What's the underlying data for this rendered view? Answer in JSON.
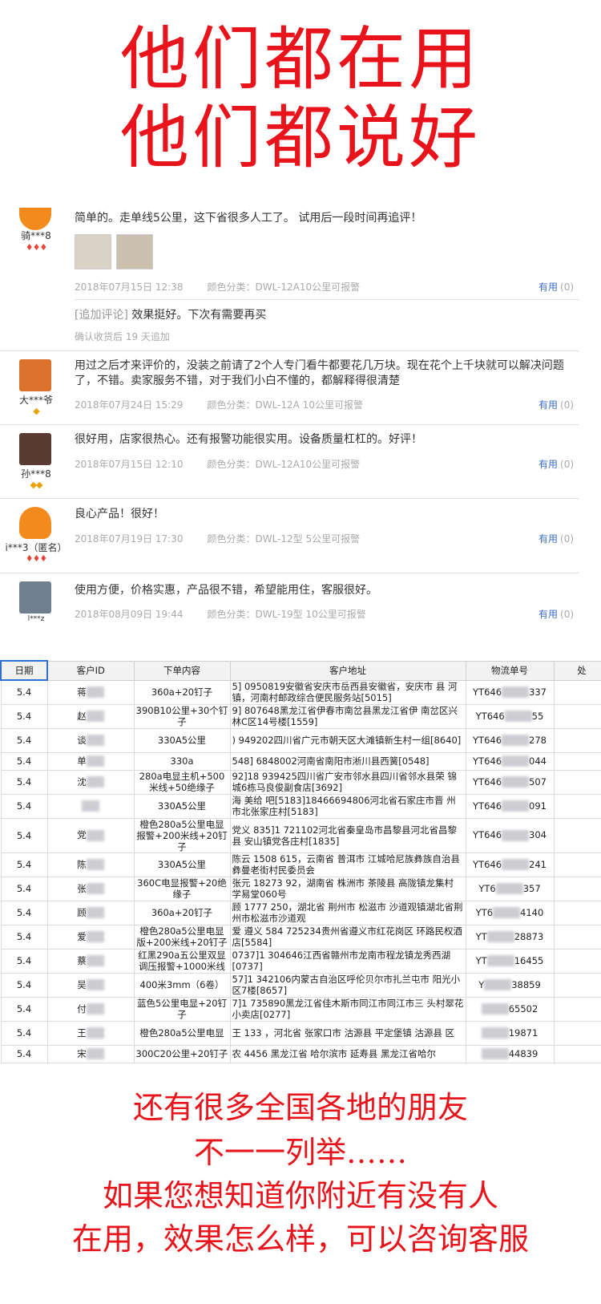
{
  "headline": {
    "line1": "他们都在用",
    "line2": "他们都说好"
  },
  "useful_label": "有用",
  "useful_count": "(0)",
  "color_prefix": "颜色分类：",
  "reviews": [
    {
      "user": "骑***8",
      "text": "简单的。走单线5公里，这下省很多人工了。 试用后一段时间再追评！",
      "date": "2018年07月15日 12:38",
      "color": "DWL-12A10公里可报警",
      "avatar_color": "#f28a1d",
      "followup_tag": "[追加评论]",
      "followup": "效果挺好。下次有需要再买",
      "followup_meta": "确认收货后 19 天追加"
    },
    {
      "user": "大***爷",
      "text": "用过之后才来评价的，没装之前请了2个人专门看牛都要花几万块。现在花个上千块就可以解决问题了，不错。卖家服务不错，对于我们小白不懂的，都解释得很清楚",
      "date": "2018年07月24日 15:29",
      "color": "DWL-12A 10公里可报警",
      "avatar_color": "#d9722a"
    },
    {
      "user": "孙***8",
      "text": "很好用，店家很热心。还有报警功能很实用。设备质量杠杠的。好评！",
      "date": "2018年07月15日 12:10",
      "color": "DWL-12A10公里可报警",
      "avatar_color": "#5a3b32"
    },
    {
      "user": "i***3（匿名）",
      "text": "良心产品！很好！",
      "date": "2018年07月19日 17:30",
      "color": "DWL-12型 5公里可报警",
      "avatar_color": "#f28a1d"
    },
    {
      "user": "l***z",
      "text": "使用方便，价格实惠，产品很不错，希望能用住，客服很好。",
      "date": "2018年08月09日 19:44",
      "color": "DWL-19型 10公里可报警",
      "avatar_color": "#6f7f8f"
    }
  ],
  "table": {
    "headers": [
      "日期",
      "客户ID",
      "下单内容",
      "客户地址",
      "物流单号",
      "处"
    ],
    "rows": [
      {
        "date": "5.4",
        "id": "蒋",
        "content": "360a+20钉子",
        "addr": "5]    0950819安徽省安庆市岳西县安徽省，安庆市    县    河镇，河南村邮政综合便民服务站[5015]",
        "track": "YT646",
        "track_tail": "337"
      },
      {
        "date": "5.4",
        "id": "赵",
        "content": "390B10公里+30个钉子",
        "addr": "9]    807648黑龙江省伊春市南岔县黑龙江省伊    南岔区兴林C区14号楼[1559]",
        "track": "YT646",
        "track_tail": "55"
      },
      {
        "date": "5.4",
        "id": "谈",
        "content": "330A5公里",
        "addr": ")    949202四川省广元市朝天区大滩镇新生村一组[8640]",
        "track": "YT646",
        "track_tail": "278"
      },
      {
        "date": "5.4",
        "id": "单",
        "content": "330a",
        "addr": "548]    6848002河南省南阳市淅川县西簧[0548]",
        "track": "YT646",
        "track_tail": "044"
      },
      {
        "date": "5.4",
        "id": "沈",
        "content": "280a电显主机+500米线+50绝缘子",
        "addr": "92]18    939425四川省广安市邻水县四川省邻水县荣    锦城6栋马良俊副食店[3692]",
        "track": "YT646",
        "track_tail": "507"
      },
      {
        "date": "5.4",
        "id": "",
        "content": "330A5公里",
        "addr": "海    美给    吧[5183]18466694806河北省石家庄市晋    州市北张家庄村[5183]",
        "track": "YT646",
        "track_tail": "091"
      },
      {
        "date": "5.4",
        "id": "党",
        "content": "橙色280a5公里电显报警+200米线+20钉子",
        "addr": "党义    835]1    721102河北省秦皇岛市昌黎县河北省昌黎县    安山镇党各庄村[1835]",
        "track": "YT646",
        "track_tail": "304"
      },
      {
        "date": "5.4",
        "id": "陈",
        "content": "330A5公里",
        "addr": "陈云    1508    615，云南省 普洱市 江城哈尼族彝族自治县    彝曼老街村民委员会",
        "track": "YT646",
        "track_tail": "241"
      },
      {
        "date": "5.4",
        "id": "张",
        "content": "360C电显报警+20绝缘子",
        "addr": "张元    18273    92，湖南省 株洲市 茶陵县 高陇镇龙集村    学易堂060号",
        "track": "YT6",
        "track_tail": "357"
      },
      {
        "date": "5.4",
        "id": "顾",
        "content": "360a+20钉子",
        "addr": "顾    1777    250，湖北省 荆州市 松滋市 沙道观镇湖北省荆州市松滋市沙道观",
        "track": "YT6",
        "track_tail": "4140"
      },
      {
        "date": "5.4",
        "id": "爱",
        "content": "橙色280a5公里电显版+200米线+20钉子",
        "addr": "爱    遵义    584    725234贵州省遵义市红花岗区    环路民权酒店[5584]",
        "track": "YT",
        "track_tail": "28873"
      },
      {
        "date": "5.4",
        "id": "蔡",
        "content": "红黑290a五公里双显调压报警+1000米线",
        "addr": "0737]1    304646江西省赣州市龙南市程龙镇龙秀西湖[0737]",
        "track": "YT",
        "track_tail": "16455"
      },
      {
        "date": "5.4",
        "id": "吴",
        "content": "400米3mm（6卷）",
        "addr": "57]1    342106内蒙古自治区呼伦贝尔市扎兰屯市    阳光小区7楼[8657]",
        "track": "Y",
        "track_tail": "38859"
      },
      {
        "date": "5.4",
        "id": "付",
        "content": "蓝色5公里电显+20钉子",
        "addr": "7]1    735890黑龙江省佳木斯市同江市同江市三    头村翠花小卖店[0277]",
        "track": "",
        "track_tail": "65502"
      },
      {
        "date": "5.4",
        "id": "王",
        "content": "橙色280a5公里电显",
        "addr": "王    133    ，河北省 张家口市 沽源县 平定堡镇 沽源县    区",
        "track": "",
        "track_tail": "19871"
      },
      {
        "date": "5.4",
        "id": "宋",
        "content": "300C20公里+20钉子",
        "addr": "农    4456    黑龙江省 哈尔滨市 延寿县 黑龙江省哈尔",
        "track": "",
        "track_tail": "44839"
      }
    ]
  },
  "bottom": {
    "line1": "还有很多全国各地的朋友",
    "line2": "不一一列举……",
    "line3": "如果您想知道你附近有没有人",
    "line4": "在用，效果怎么样，可以咨询客服"
  }
}
